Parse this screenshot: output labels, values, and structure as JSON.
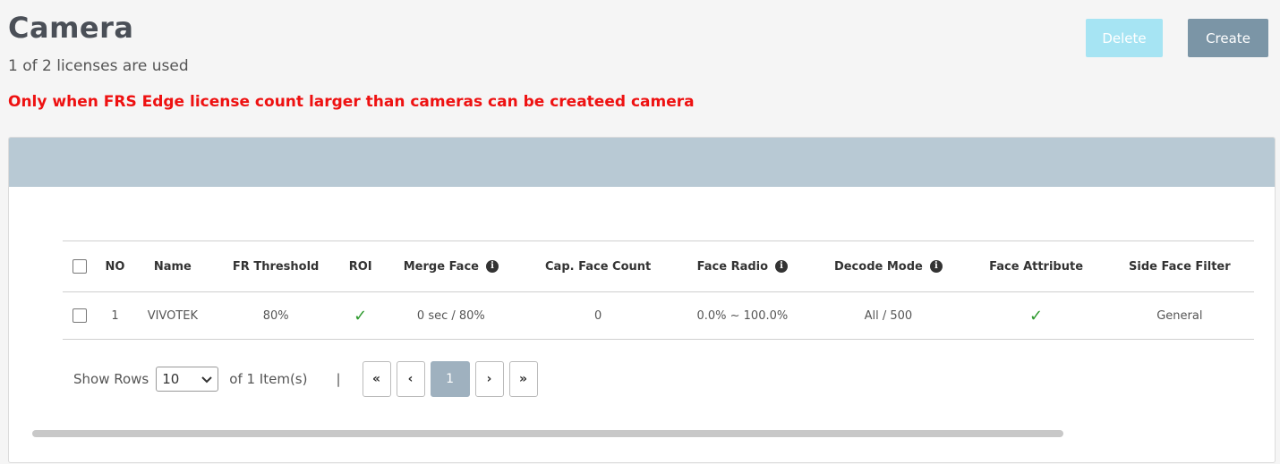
{
  "header": {
    "title": "Camera",
    "license_text": "1 of 2 licenses are used",
    "warning": "Only when FRS Edge license count larger than cameras can be createed camera"
  },
  "toolbar": {
    "delete_label": "Delete",
    "create_label": "Create"
  },
  "table": {
    "columns": [
      "NO",
      "Name",
      "FR Threshold",
      "ROI",
      "Merge Face",
      "Cap. Face Count",
      "Face Radio",
      "Decode Mode",
      "Face Attribute",
      "Side Face Filter"
    ],
    "rows": [
      {
        "no": "1",
        "name": "VIVOTEK",
        "fr_threshold": "80%",
        "roi": "check-icon",
        "merge_face": "0 sec / 80%",
        "cap_face_count": "0",
        "face_radio": "0.0% ~ 100.0%",
        "decode_mode": "All / 500",
        "face_attribute": "check-icon",
        "side_face_filter": "General"
      }
    ]
  },
  "pagination": {
    "show_rows_label": "Show Rows",
    "rows_value": "10",
    "item_count": "of 1 Item(s)",
    "separator": "|",
    "first": "«",
    "prev": "‹",
    "current_page": "1",
    "next": "›",
    "last": "»"
  },
  "colors": {
    "warning": "#ee1111",
    "create_button": "#7b95a6",
    "delete_button_disabled": "#a6e4f3",
    "panel_header": "#b8c9d4",
    "check": "#2e9a2e"
  }
}
